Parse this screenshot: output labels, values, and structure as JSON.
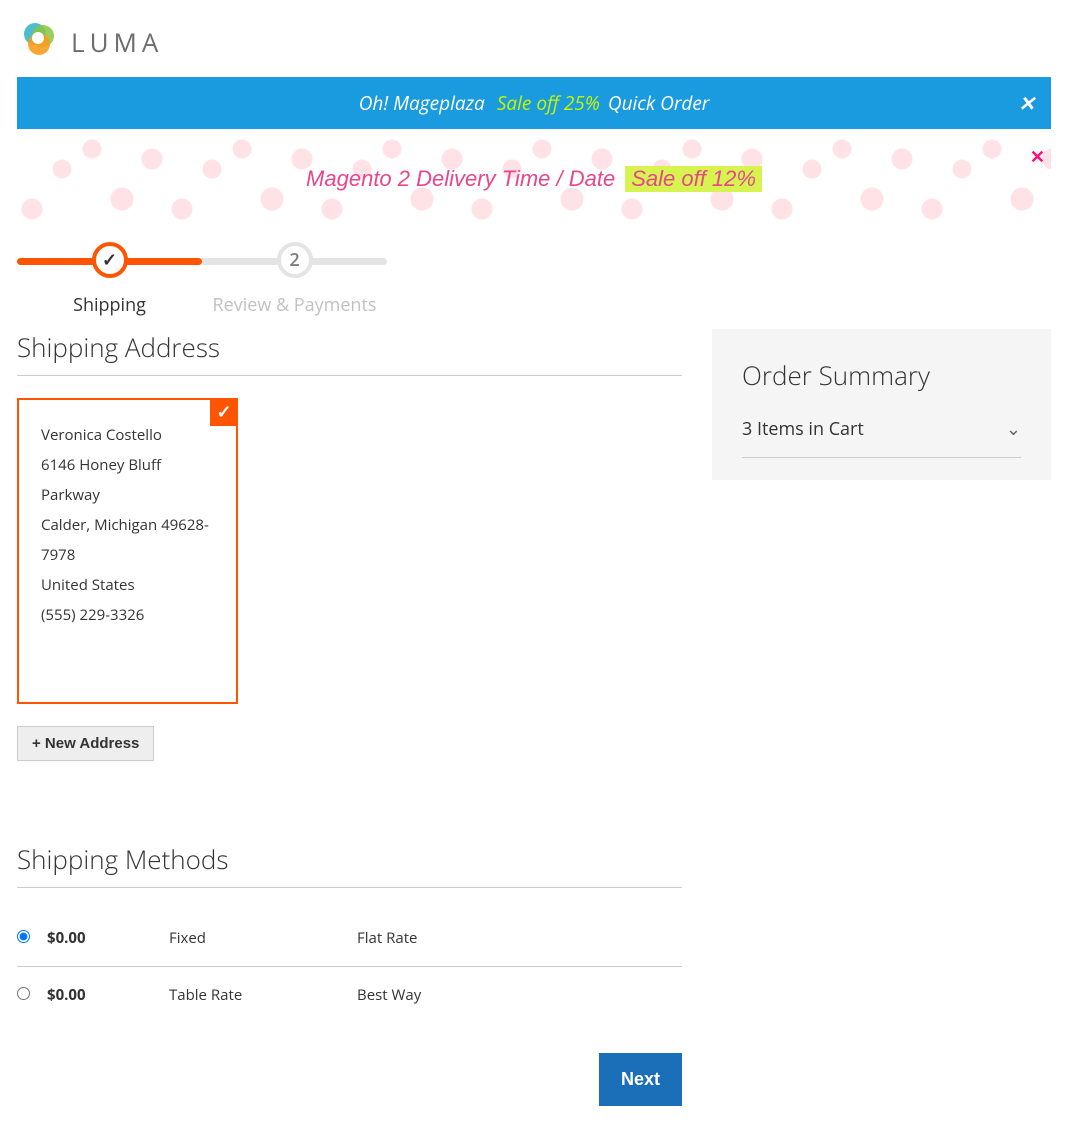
{
  "logo_text": "LUMA",
  "banner_blue": {
    "part1": "Oh! Mageplaza",
    "sale": "Sale off 25%",
    "part2": "Quick Order"
  },
  "banner_pink": {
    "text": "Magento 2 Delivery Time / Date",
    "sale": "Sale off 12%"
  },
  "progress": {
    "step1_label": "Shipping",
    "step2_num": "2",
    "step2_label": "Review & Payments"
  },
  "shipping_address": {
    "title": "Shipping Address",
    "name": "Veronica Costello",
    "street": "6146 Honey Bluff Parkway",
    "city_line": "Calder, Michigan 49628-7978",
    "country": "United States",
    "phone": "(555) 229-3326",
    "new_button": "+ New Address"
  },
  "shipping_methods": {
    "title": "Shipping Methods",
    "rows": [
      {
        "price": "$0.00",
        "type": "Fixed",
        "carrier": "Flat Rate",
        "selected": true
      },
      {
        "price": "$0.00",
        "type": "Table Rate",
        "carrier": "Best Way",
        "selected": false
      }
    ],
    "next": "Next"
  },
  "summary": {
    "title": "Order Summary",
    "cart_line": "3 Items in Cart"
  }
}
